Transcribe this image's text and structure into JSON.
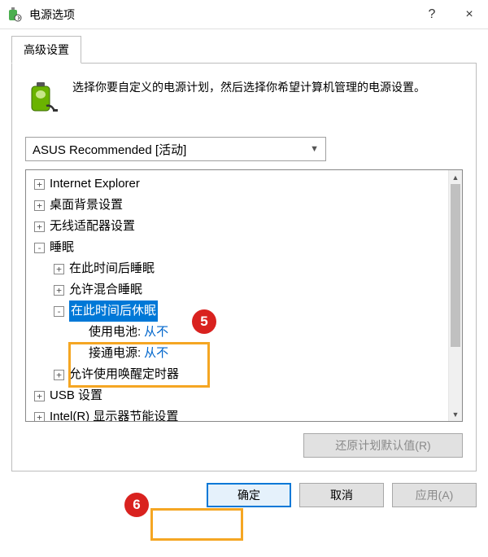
{
  "window": {
    "title": "电源选项",
    "help_tooltip": "?",
    "close_tooltip": "×"
  },
  "tab": {
    "label": "高级设置"
  },
  "description": "选择你要自定义的电源计划，然后选择你希望计算机管理的电源设置。",
  "plan_select": {
    "value": "ASUS Recommended [活动]"
  },
  "tree": {
    "items": [
      {
        "level": 0,
        "exp": "+",
        "label": "Internet Explorer"
      },
      {
        "level": 0,
        "exp": "+",
        "label": "桌面背景设置"
      },
      {
        "level": 0,
        "exp": "+",
        "label": "无线适配器设置"
      },
      {
        "level": 0,
        "exp": "-",
        "label": "睡眠"
      },
      {
        "level": 1,
        "exp": "+",
        "label": "在此时间后睡眠"
      },
      {
        "level": 1,
        "exp": "+",
        "label": "允许混合睡眠"
      },
      {
        "level": 1,
        "exp": "-",
        "label": "在此时间后休眠",
        "selected": true
      },
      {
        "level": 2,
        "exp": " ",
        "label": "使用电池:",
        "value": "从不"
      },
      {
        "level": 2,
        "exp": " ",
        "label": "接通电源:",
        "value": "从不"
      },
      {
        "level": 1,
        "exp": "+",
        "label": "允许使用唤醒定时器"
      },
      {
        "level": 0,
        "exp": "+",
        "label": "USB 设置"
      },
      {
        "level": 0,
        "exp": "+",
        "label": "Intel(R) 显示器节能设置"
      }
    ]
  },
  "buttons": {
    "restore": "还原计划默认值(R)",
    "ok": "确定",
    "cancel": "取消",
    "apply": "应用(A)"
  },
  "callouts": {
    "five": "5",
    "six": "6"
  }
}
